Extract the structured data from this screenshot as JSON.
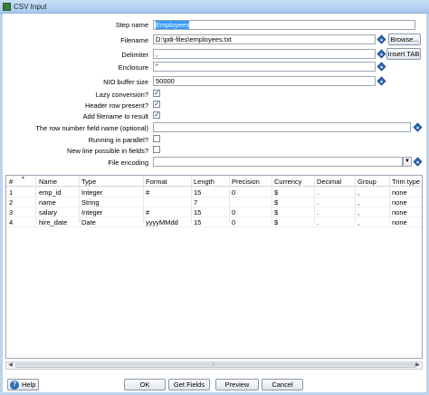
{
  "window": {
    "title": "CSV Input"
  },
  "form": {
    "step_name": {
      "label": "Step name",
      "value": "Employees"
    },
    "filename": {
      "label": "Filename",
      "value": "D:\\pdi-files\\employees.txt",
      "browse_label": "Browse..."
    },
    "delimiter": {
      "label": "Delimiter",
      "value": ",",
      "insert_tab_label": "Insert TAB"
    },
    "enclosure": {
      "label": "Enclosure",
      "value": "\""
    },
    "nio_buffer": {
      "label": "NIO buffer size",
      "value": "50000"
    },
    "lazy_conversion": {
      "label": "Lazy conversion?",
      "checked": true
    },
    "header_row": {
      "label": "Header row present?",
      "checked": true
    },
    "add_filename": {
      "label": "Add filename to result",
      "checked": true
    },
    "row_number_field": {
      "label": "The row number field name (optional)",
      "value": ""
    },
    "running_parallel": {
      "label": "Running in parallel?",
      "checked": false
    },
    "new_line_possible": {
      "label": "New line possible in fields?",
      "checked": false
    },
    "file_encoding": {
      "label": "File encoding",
      "value": ""
    }
  },
  "table": {
    "headers": [
      "#",
      "Name",
      "Type",
      "Format",
      "Length",
      "Precision",
      "Currency",
      "Decimal",
      "Group",
      "Trim type"
    ],
    "rows": [
      [
        "1",
        "emp_id",
        "Integer",
        "#",
        "15",
        "0",
        "$",
        ".",
        ",",
        "none"
      ],
      [
        "2",
        "name",
        "String",
        "",
        "7",
        "",
        "$",
        ".",
        ",",
        "none"
      ],
      [
        "3",
        "salary",
        "Integer",
        "#",
        "15",
        "0",
        "$",
        ".",
        ",",
        "none"
      ],
      [
        "4",
        "hire_date",
        "Date",
        "yyyyMMdd",
        "15",
        "0",
        "$",
        ".",
        ",",
        "none"
      ]
    ]
  },
  "buttons": {
    "help": "Help",
    "ok": "OK",
    "get_fields": "Get Fields",
    "preview": "Preview",
    "cancel": "Cancel"
  },
  "icons": {
    "variable": "variable-diamond-icon",
    "help": "question-icon",
    "app": "csv-input-icon"
  },
  "colors": {
    "accent": "#2f6db5",
    "selection": "#3399ff",
    "titlebar": "#bcd3ee"
  }
}
